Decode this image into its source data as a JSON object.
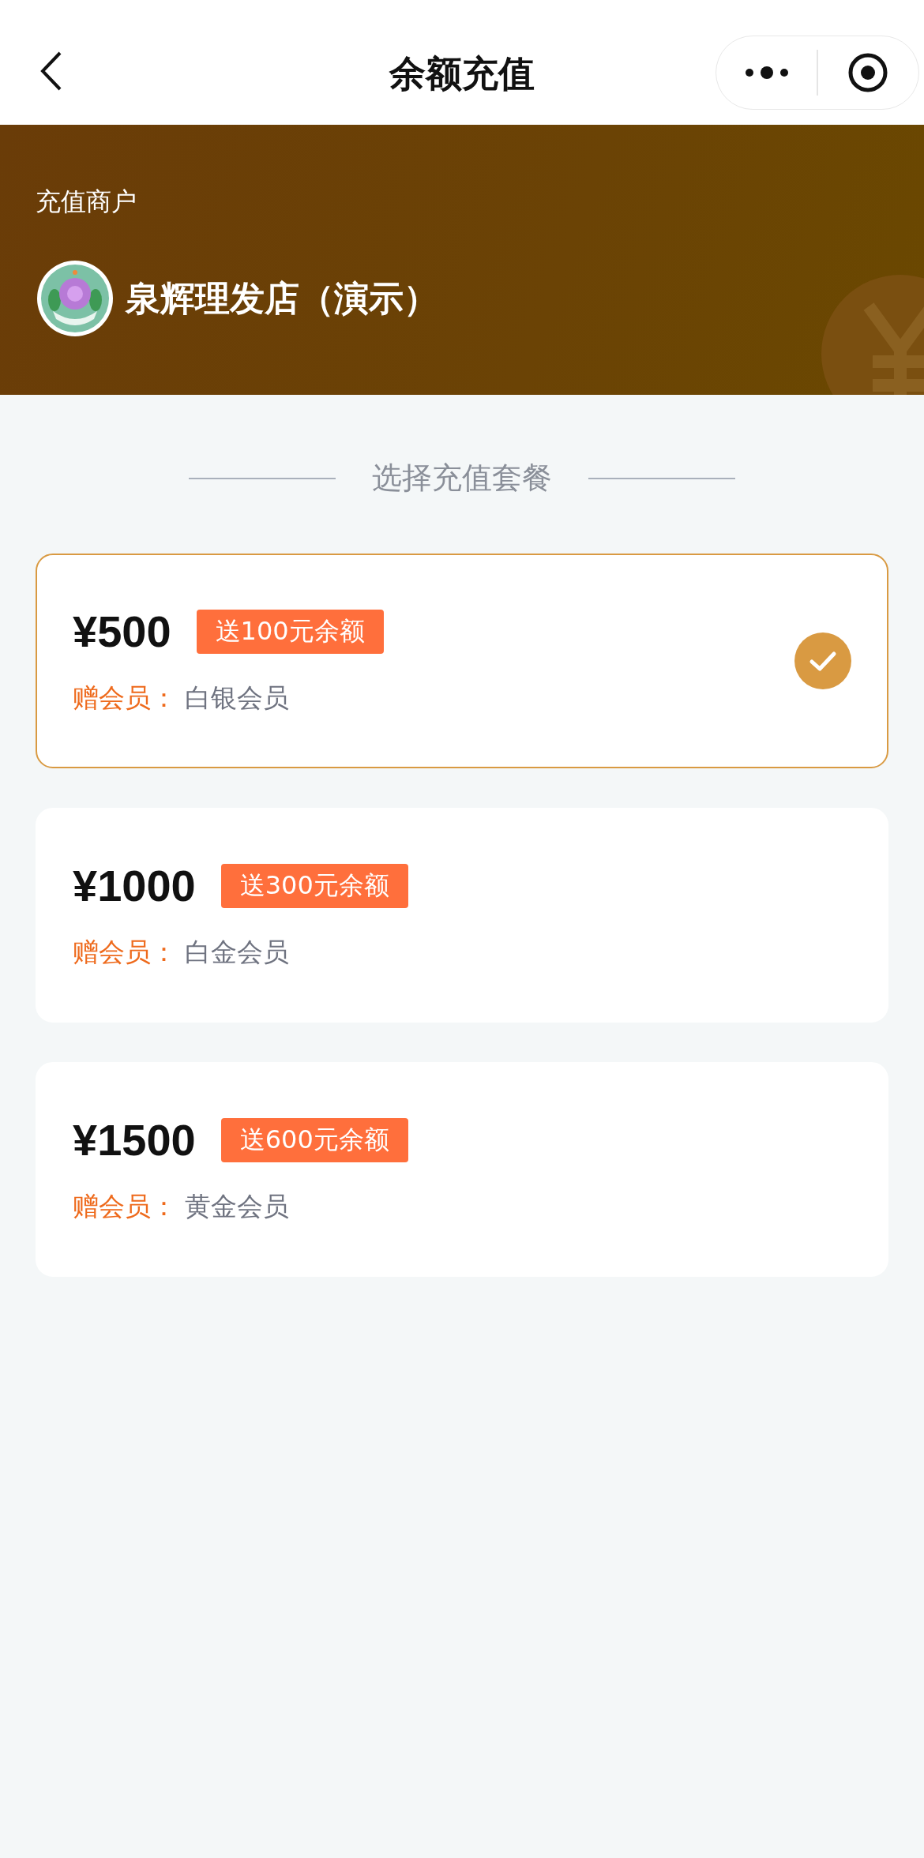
{
  "nav": {
    "title": "余额充值"
  },
  "merchant": {
    "label": "充值商户",
    "name": "泉辉理发店（演示）"
  },
  "section_title": "选择充值套餐",
  "packages": [
    {
      "price": "¥500",
      "bonus": "送100元余额",
      "gift_label": "赠会员：",
      "gift": "白银会员",
      "selected": true
    },
    {
      "price": "¥1000",
      "bonus": "送300元余额",
      "gift_label": "赠会员：",
      "gift": "白金会员",
      "selected": false
    },
    {
      "price": "¥1500",
      "bonus": "送600元余额",
      "gift_label": "赠会员：",
      "gift": "黄金会员",
      "selected": false
    }
  ]
}
